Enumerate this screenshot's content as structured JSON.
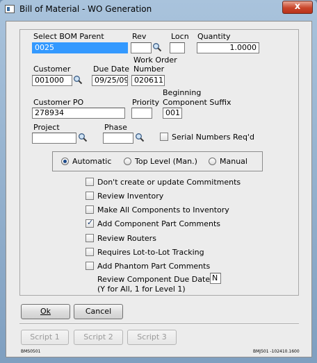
{
  "window": {
    "title": "Bill of Material - WO Generation",
    "close_label": "x"
  },
  "fields": {
    "bom_parent": {
      "label": "Select BOM Parent",
      "value": "0025"
    },
    "rev": {
      "label": "Rev",
      "value": ""
    },
    "locn": {
      "label": "Locn",
      "value": ""
    },
    "quantity": {
      "label": "Quantity",
      "value": "1.0000"
    },
    "customer": {
      "label": "Customer",
      "value": "001000"
    },
    "due_date": {
      "label": "Due Date",
      "value": "09/25/09"
    },
    "work_order": {
      "label_line1": "Work Order",
      "label_line2": "Number",
      "value": "020611"
    },
    "customer_po": {
      "label": "Customer PO",
      "value": "278934"
    },
    "priority": {
      "label": "Priority",
      "value": ""
    },
    "suffix": {
      "label_line1": "Beginning",
      "label_line2": "Component Suffix",
      "value": "001"
    },
    "project": {
      "label": "Project",
      "value": ""
    },
    "phase": {
      "label": "Phase",
      "value": ""
    }
  },
  "serial_required": {
    "label": "Serial Numbers Req'd",
    "checked": false
  },
  "mode": {
    "options": [
      "Automatic",
      "Top Level (Man.)",
      "Manual"
    ],
    "selected": "Automatic"
  },
  "options": [
    {
      "label": "Don't create or update Commitments",
      "checked": false
    },
    {
      "label": "Review Inventory",
      "checked": false
    },
    {
      "label": "Make All Components to Inventory",
      "checked": false
    },
    {
      "label": "Add Component Part Comments",
      "checked": true
    },
    {
      "label": "Review Routers",
      "checked": false
    },
    {
      "label": "Requires Lot-to-Lot Tracking",
      "checked": false
    },
    {
      "label": "Add Phantom Part Comments",
      "checked": false
    }
  ],
  "review_due_dates": {
    "label_line1": "Review Component Due Dates?",
    "label_line2": "(Y for All, 1 for Level 1)",
    "value": "N"
  },
  "buttons": {
    "ok": "Ok",
    "cancel": "Cancel"
  },
  "scripts": [
    "Script 1",
    "Script 2",
    "Script 3"
  ],
  "status": {
    "left": "BMS0501",
    "right": "BMJ501 -102410.1600"
  }
}
